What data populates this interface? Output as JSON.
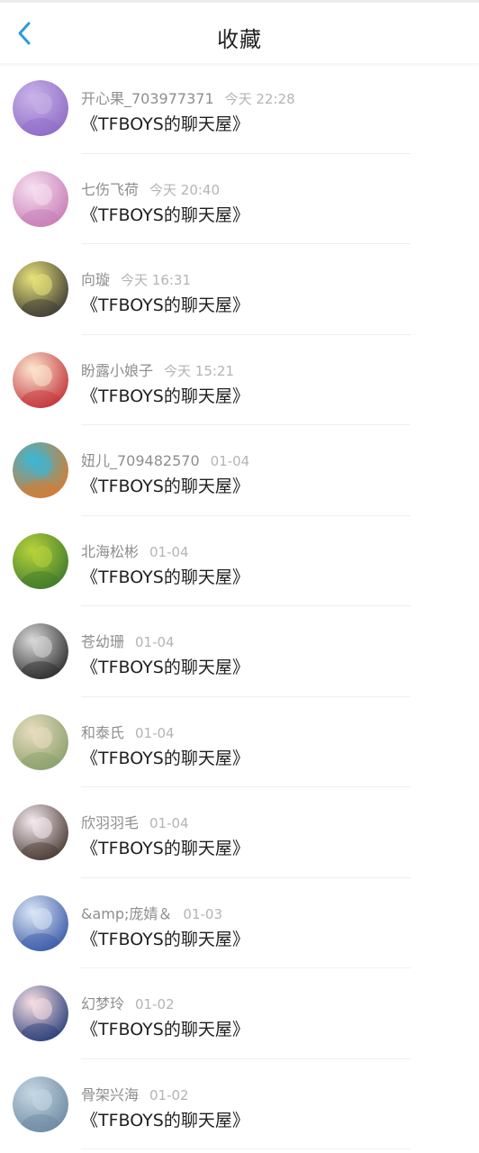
{
  "header": {
    "title": "收藏",
    "back_icon": "chevron-left-icon",
    "accent_color": "#2a9bdc"
  },
  "items": [
    {
      "name": "开心果_703977371",
      "time": "今天 22:28",
      "content": "《TFBOYS的聊天屋》",
      "avatar_colors": [
        "#c9b3e8",
        "#8f6cc7"
      ]
    },
    {
      "name": "七伤飞荷",
      "time": "今天 20:40",
      "content": "《TFBOYS的聊天屋》",
      "avatar_colors": [
        "#f6dff0",
        "#c87cb6"
      ]
    },
    {
      "name": "向璇",
      "time": "今天 16:31",
      "content": "《TFBOYS的聊天屋》",
      "avatar_colors": [
        "#e9e37a",
        "#3d3a34"
      ]
    },
    {
      "name": "盼露小娘子",
      "time": "今天 15:21",
      "content": "《TFBOYS的聊天屋》",
      "avatar_colors": [
        "#fbe7d0",
        "#c4333a"
      ]
    },
    {
      "name": "妞儿_709482570",
      "time": "01-04",
      "content": "《TFBOYS的聊天屋》",
      "avatar_colors": [
        "#3bb7d6",
        "#d97b2e"
      ]
    },
    {
      "name": "北海松彬",
      "time": "01-04",
      "content": "《TFBOYS的聊天屋》",
      "avatar_colors": [
        "#b7d33c",
        "#3f7a2b"
      ]
    },
    {
      "name": "苍幼珊",
      "time": "01-04",
      "content": "《TFBOYS的聊天屋》",
      "avatar_colors": [
        "#d9d9d9",
        "#2d2d2d"
      ]
    },
    {
      "name": "和泰氏",
      "time": "01-04",
      "content": "《TFBOYS的聊天屋》",
      "avatar_colors": [
        "#e9ddc0",
        "#8aa06a"
      ]
    },
    {
      "name": "欣羽羽毛",
      "time": "01-04",
      "content": "《TFBOYS的聊天屋》",
      "avatar_colors": [
        "#f5eaf0",
        "#4a3a33"
      ]
    },
    {
      "name": "&amp;庞婧＆",
      "time": "01-03",
      "content": "《TFBOYS的聊天屋》",
      "avatar_colors": [
        "#dbe7f6",
        "#3b5aa8"
      ]
    },
    {
      "name": "幻梦玲",
      "time": "01-02",
      "content": "《TFBOYS的聊天屋》",
      "avatar_colors": [
        "#f8dfe3",
        "#2a3f7a"
      ]
    },
    {
      "name": "骨架兴海",
      "time": "01-02",
      "content": "《TFBOYS的聊天屋》",
      "avatar_colors": [
        "#c7d8e4",
        "#6d8aa2"
      ]
    }
  ]
}
